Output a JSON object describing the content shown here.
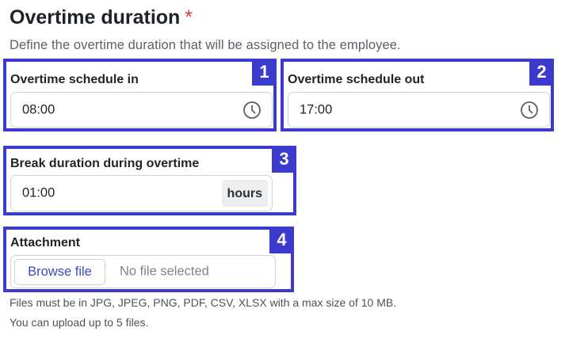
{
  "section": {
    "title": "Overtime duration",
    "required_mark": "*",
    "description": "Define the overtime duration that will be assigned to the employee."
  },
  "fields": {
    "schedule_in": {
      "badge": "1",
      "label": "Overtime schedule in",
      "value": "08:00",
      "icon": "clock-icon"
    },
    "schedule_out": {
      "badge": "2",
      "label": "Overtime schedule out",
      "value": "17:00",
      "icon": "clock-icon"
    },
    "break_duration": {
      "badge": "3",
      "label": "Break duration during overtime",
      "value": "01:00",
      "unit": "hours"
    },
    "attachment": {
      "badge": "4",
      "label": "Attachment",
      "browse_label": "Browse file",
      "status": "No file selected"
    }
  },
  "help": {
    "formats": "Files must be in JPG, JPEG, PNG, PDF, CSV, XLSX with a max size of 10 MB.",
    "limit": "You can upload up to 5 files."
  },
  "colors": {
    "highlight": "#3a3bcc",
    "required": "#d63a3a",
    "browse_text": "#3e4bb8"
  }
}
